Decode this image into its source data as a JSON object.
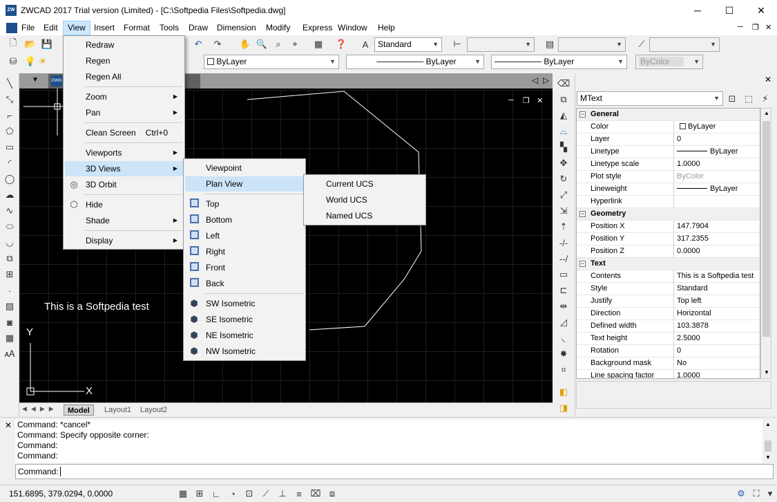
{
  "title": "ZWCAD 2017 Trial version (Limited) - [C:\\Softpedia Files\\Softpedia.dwg]",
  "app_icon_text": "ZW",
  "window_controls": {
    "minimize": "─",
    "maximize": "☐",
    "close": "✕"
  },
  "menubar": {
    "items": [
      "File",
      "Edit",
      "View",
      "Insert",
      "Format",
      "Tools",
      "Draw",
      "Dimension",
      "Modify",
      "Express",
      "Window",
      "Help"
    ],
    "active": "View"
  },
  "toolbar": {
    "text_style": "Standard",
    "layer_color": "ByLayer",
    "linetype": "ByLayer",
    "lineweight": "ByLayer",
    "plot_style": "ByColor"
  },
  "drawing_tab": {
    "icon": "DWG"
  },
  "canvas": {
    "text": "This is a Softpedia test",
    "ucs_x": "X",
    "ucs_y": "Y",
    "accent": "#000000"
  },
  "layout_tabs": [
    "Model",
    "Layout1",
    "Layout2"
  ],
  "view_menu": {
    "items": [
      {
        "label": "Redraw"
      },
      {
        "label": "Regen"
      },
      {
        "label": "Regen All"
      },
      {
        "label": "Zoom",
        "sub": "▶"
      },
      {
        "label": "Pan",
        "sub": "▶"
      },
      {
        "label": "Clean Screen",
        "shortcut": "Ctrl+0"
      },
      {
        "label": "Viewports",
        "sub": "▶"
      },
      {
        "label": "3D Views",
        "sub": "▶"
      },
      {
        "label": "3D Orbit"
      },
      {
        "label": "Hide"
      },
      {
        "label": "Shade",
        "sub": "▶"
      },
      {
        "label": "Display",
        "sub": "▶"
      }
    ]
  },
  "views3d_menu": {
    "items": [
      "Viewpoint",
      "Plan View",
      "Top",
      "Bottom",
      "Left",
      "Right",
      "Front",
      "Back",
      "SW Isometric",
      "SE Isometric",
      "NE Isometric",
      "NW Isometric"
    ]
  },
  "planview_menu": {
    "items": [
      "Current UCS",
      "World UCS",
      "Named UCS"
    ]
  },
  "properties": {
    "selector": "MText",
    "groups": [
      {
        "name": "General",
        "rows": [
          [
            "Color",
            "ByLayer"
          ],
          [
            "Layer",
            "0"
          ],
          [
            "Linetype",
            "ByLayer"
          ],
          [
            "Linetype scale",
            "1.0000"
          ],
          [
            "Plot style",
            "ByColor"
          ],
          [
            "Lineweight",
            "ByLayer"
          ],
          [
            "Hyperlink",
            ""
          ]
        ]
      },
      {
        "name": "Geometry",
        "rows": [
          [
            "Position X",
            "147.7904"
          ],
          [
            "Position Y",
            "317.2355"
          ],
          [
            "Position Z",
            "0.0000"
          ]
        ]
      },
      {
        "name": "Text",
        "rows": [
          [
            "Contents",
            "This is a Softpedia test"
          ],
          [
            "Style",
            "Standard"
          ],
          [
            "Justify",
            "Top left"
          ],
          [
            "Direction",
            "Horizontal"
          ],
          [
            "Defined width",
            "103.3878"
          ],
          [
            "Text height",
            "2.5000"
          ],
          [
            "Rotation",
            "0"
          ],
          [
            "Background mask",
            "No"
          ],
          [
            "Line spacing factor",
            "1.0000"
          ]
        ]
      }
    ]
  },
  "command": {
    "log": [
      "Command: *cancel*",
      "Command: Specify opposite corner:",
      "Command:",
      "Command:"
    ],
    "prompt": "Command:"
  },
  "status": {
    "coords": "151.6895, 379.0294, 0.0000"
  }
}
